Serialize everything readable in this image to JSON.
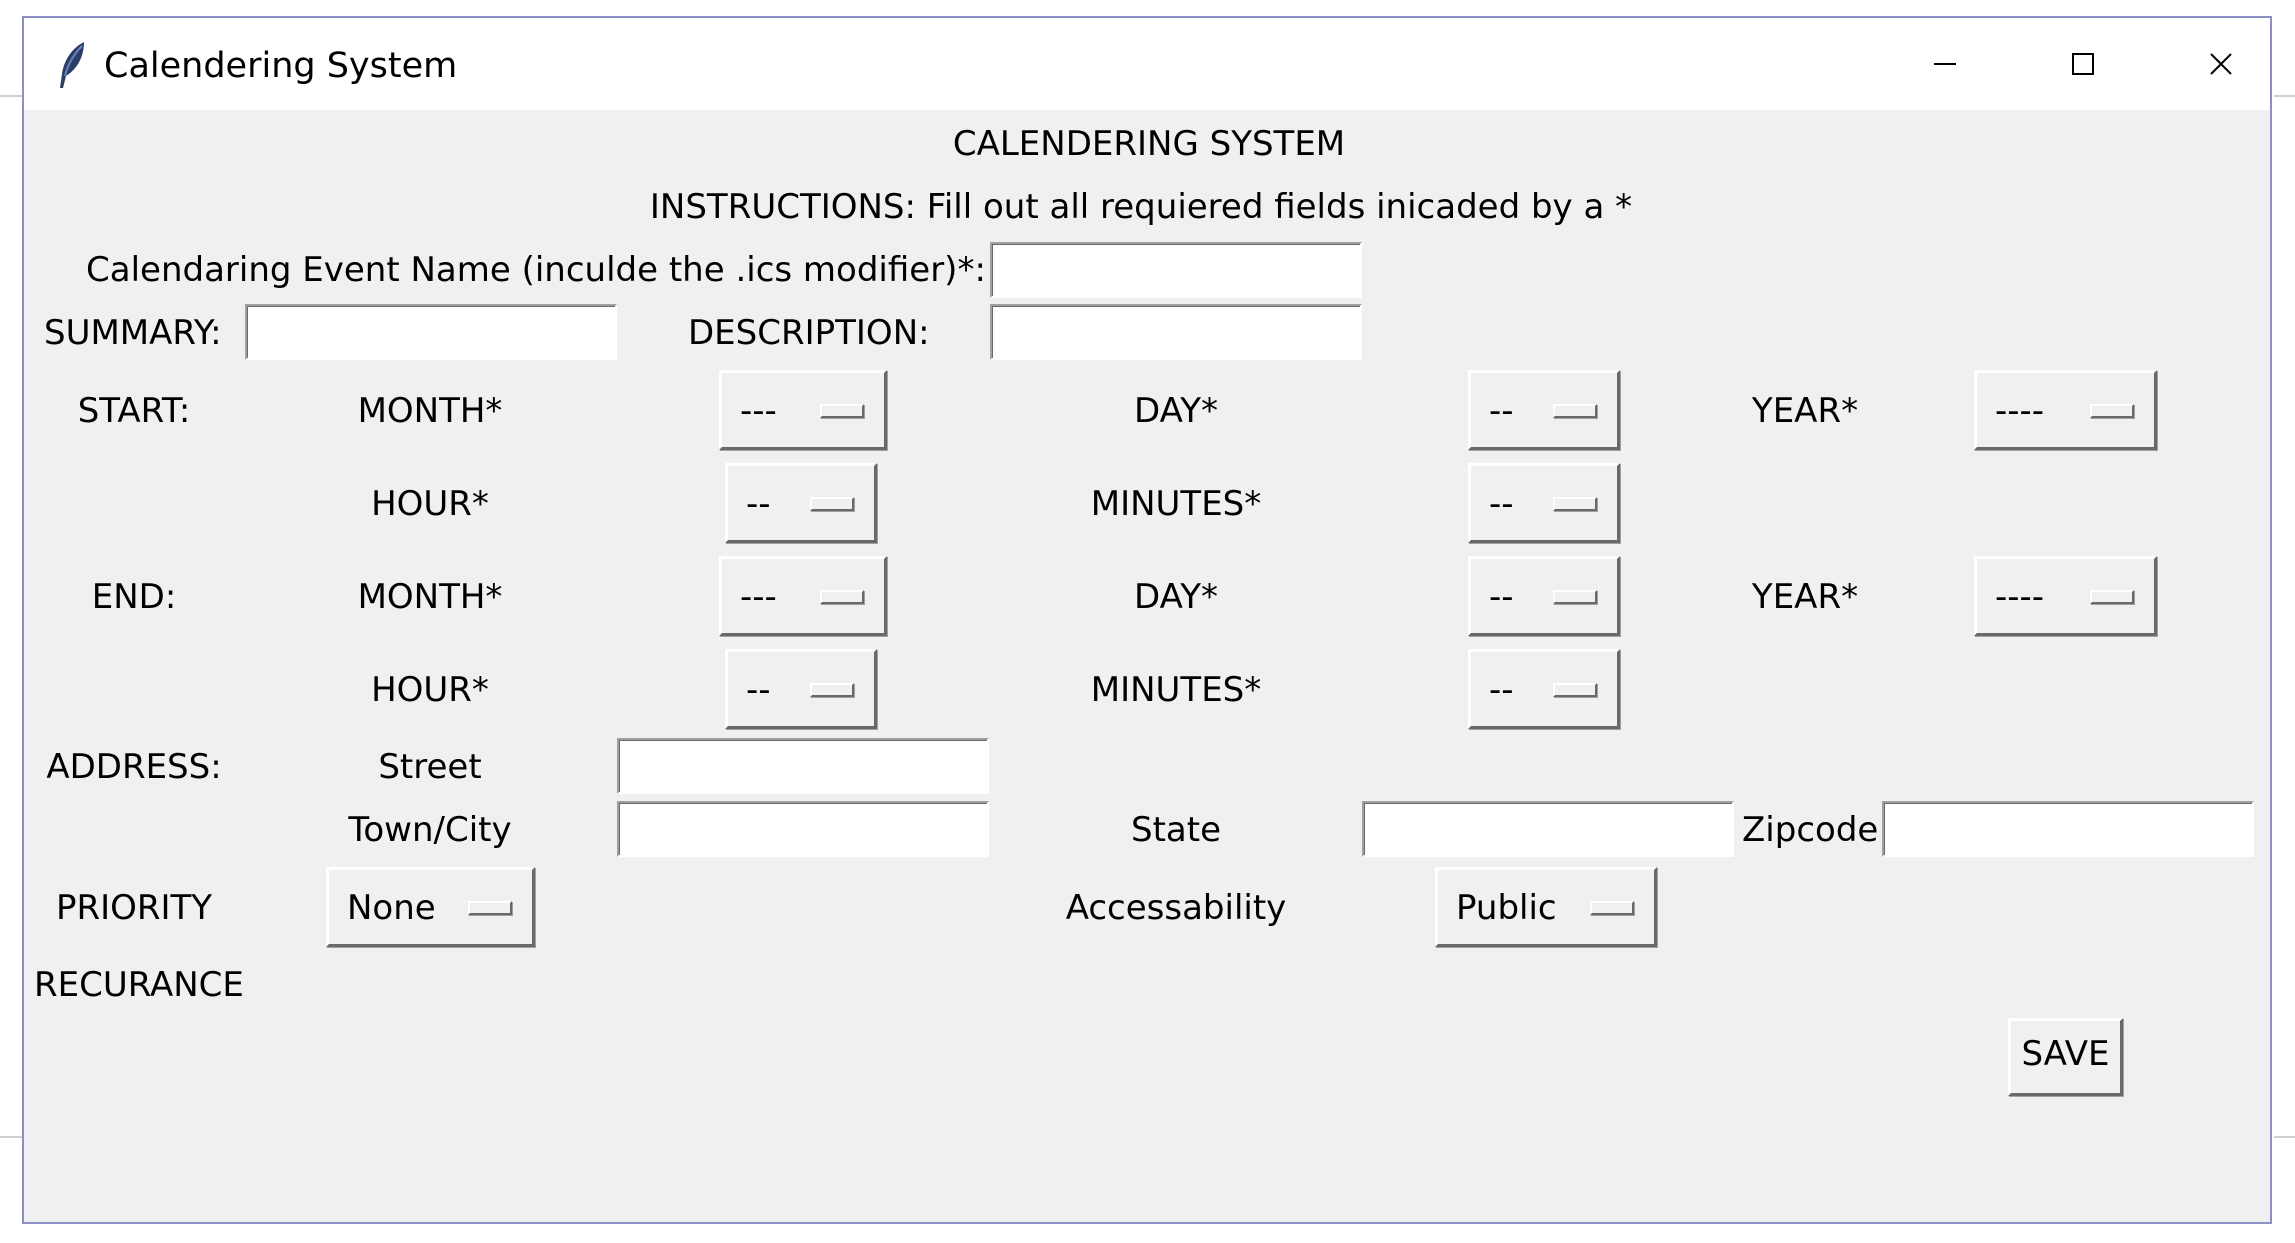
{
  "window": {
    "title": "Calendering System",
    "icon": "feather-icon"
  },
  "heading": "CALENDERING SYSTEM",
  "instructions": "INSTRUCTIONS: Fill out all requiered fields inicaded by a *",
  "event_name": {
    "label": "Calendaring Event Name (inculde the .ics modifier)*:",
    "value": ""
  },
  "summary": {
    "label": "SUMMARY:",
    "value": ""
  },
  "description": {
    "label": "DESCRIPTION:",
    "value": ""
  },
  "start": {
    "label": "START:",
    "month_label": "MONTH*",
    "month_value": "---",
    "day_label": "DAY*",
    "day_value": "--",
    "year_label": "YEAR*",
    "year_value": "----",
    "hour_label": "HOUR*",
    "hour_value": "--",
    "minutes_label": "MINUTES*",
    "minutes_value": "--"
  },
  "end": {
    "label": "END:",
    "month_label": "MONTH*",
    "month_value": "---",
    "day_label": "DAY*",
    "day_value": "--",
    "year_label": "YEAR*",
    "year_value": "----",
    "hour_label": "HOUR*",
    "hour_value": "--",
    "minutes_label": "MINUTES*",
    "minutes_value": "--"
  },
  "address": {
    "label": "ADDRESS:",
    "street_label": "Street",
    "street_value": "",
    "city_label": "Town/City",
    "city_value": "",
    "state_label": "State",
    "state_value": "",
    "zip_label": "Zipcode",
    "zip_value": ""
  },
  "priority": {
    "label": "PRIORITY",
    "value": "None"
  },
  "accessibility": {
    "label": "Accessability",
    "value": "Public"
  },
  "recurrence": {
    "label": "RECURANCE"
  },
  "save_label": "SAVE"
}
